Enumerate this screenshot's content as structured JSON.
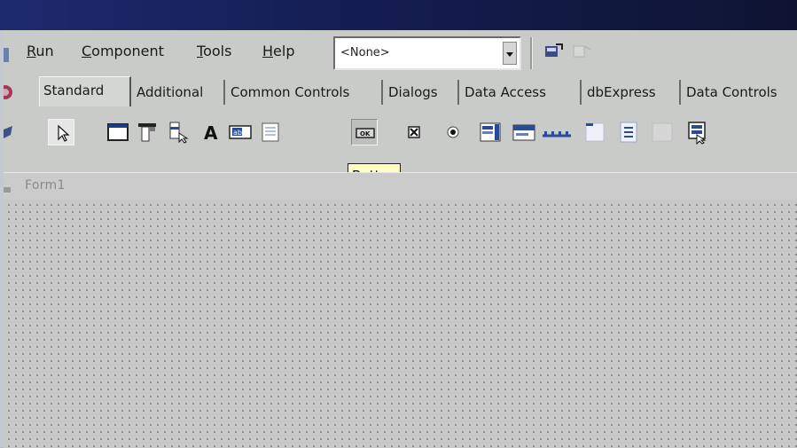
{
  "menu": {
    "items": [
      {
        "label": "Run"
      },
      {
        "label": "Component"
      },
      {
        "label": "Tools"
      },
      {
        "label": "Help"
      }
    ]
  },
  "toolbar": {
    "combo_value": "<None>"
  },
  "palette": {
    "tabs": [
      {
        "label": "Standard"
      },
      {
        "label": "Additional"
      },
      {
        "label": "Common Controls"
      },
      {
        "label": "Dialogs"
      },
      {
        "label": "Data Access"
      },
      {
        "label": "dbExpress"
      },
      {
        "label": "Data Controls"
      }
    ],
    "active_tab": "Standard",
    "components": [
      {
        "icon": "pointer-arrow-icon"
      },
      {
        "icon": "frame-icon"
      },
      {
        "icon": "main-menu-icon"
      },
      {
        "icon": "popup-menu-icon"
      },
      {
        "icon": "label-icon"
      },
      {
        "icon": "edit-icon"
      },
      {
        "icon": "memo-icon"
      },
      {
        "icon": "button-icon"
      },
      {
        "icon": "checkbox-icon"
      },
      {
        "icon": "radiobutton-icon"
      },
      {
        "icon": "listbox-icon"
      },
      {
        "icon": "combobox-icon"
      },
      {
        "icon": "scrollbar-icon"
      },
      {
        "icon": "groupbox-icon"
      },
      {
        "icon": "radiogroup-icon"
      },
      {
        "icon": "panel-icon"
      },
      {
        "icon": "actionlist-icon"
      }
    ]
  },
  "tooltip": {
    "text": "Button"
  },
  "form": {
    "caption": "Form1"
  },
  "colors": {
    "titlebar": "#1d2a6e",
    "tooltip_bg": "#ffffc2",
    "face": "#c9cbc9"
  }
}
